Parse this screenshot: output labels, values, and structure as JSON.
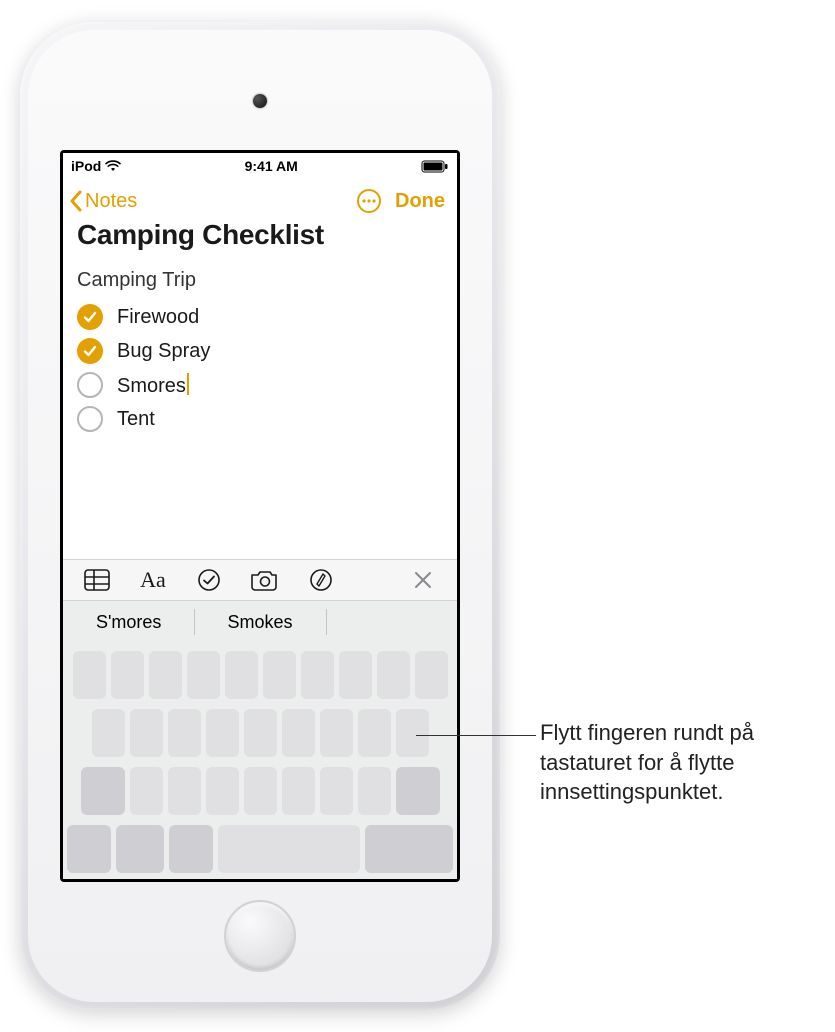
{
  "status": {
    "carrier": "iPod",
    "time": "9:41 AM"
  },
  "nav": {
    "back_label": "Notes",
    "done_label": "Done"
  },
  "note": {
    "title": "Camping Checklist",
    "subtitle": "Camping Trip",
    "items": [
      {
        "label": "Firewood",
        "checked": true,
        "cursor": false
      },
      {
        "label": "Bug Spray",
        "checked": true,
        "cursor": false
      },
      {
        "label": "Smores",
        "checked": false,
        "cursor": true
      },
      {
        "label": "Tent",
        "checked": false,
        "cursor": false
      }
    ]
  },
  "suggestions": [
    "S'mores",
    "Smokes",
    ""
  ],
  "callout": "Flytt fingeren rundt på tastaturet for å flytte innsettingspunktet.",
  "colors": {
    "accent": "#e2a100"
  }
}
